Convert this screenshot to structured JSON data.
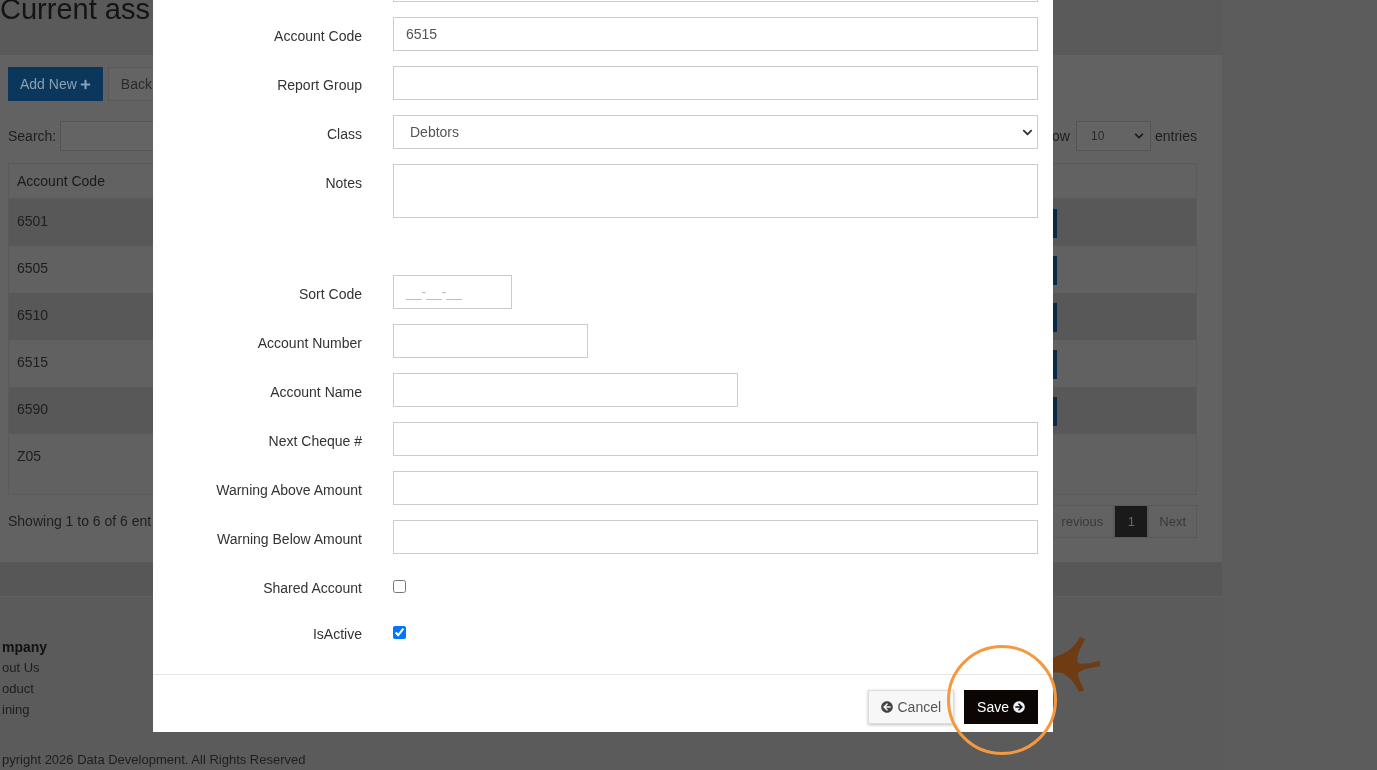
{
  "page": {
    "title": "Current ass",
    "add_button": "Add New",
    "back_button": "Back",
    "search_label": "Search:",
    "length_prefix": "ow",
    "length_value": "10",
    "length_suffix": "entries",
    "table": {
      "columns": [
        "Account Code"
      ],
      "rows": [
        {
          "code": "6501",
          "has_action": true
        },
        {
          "code": "6505",
          "has_action": true
        },
        {
          "code": "6510",
          "has_action": true
        },
        {
          "code": "6515",
          "has_action": true
        },
        {
          "code": "6590",
          "has_action": true
        },
        {
          "code": "Z05",
          "has_action": false
        }
      ]
    },
    "info": "Showing 1 to 6 of 6 ent",
    "pagination": [
      {
        "label": "revious",
        "selected": false
      },
      {
        "label": "1",
        "selected": true
      },
      {
        "label": "Next",
        "selected": false
      }
    ]
  },
  "footer": {
    "heading": "mpany",
    "links": [
      "out Us",
      "oduct",
      "ining"
    ],
    "copyright": "pyright 2026 Data Development. All Rights Reserved"
  },
  "modal": {
    "fields": [
      {
        "kind": "text"
      },
      {
        "kind": "text",
        "label": "Account Code",
        "value": "6515"
      },
      {
        "kind": "text",
        "label": "Report Group"
      },
      {
        "kind": "select",
        "label": "Class",
        "value": "Debtors"
      },
      {
        "kind": "textarea",
        "label": "Notes"
      },
      {
        "kind": "sort_code",
        "label": "Sort Code",
        "placeholder": "__-__-__"
      },
      {
        "kind": "account_number",
        "label": "Account Number"
      },
      {
        "kind": "account_name",
        "label": "Account Name"
      },
      {
        "kind": "text",
        "label": "Next Cheque #"
      },
      {
        "kind": "text",
        "label": "Warning Above Amount"
      },
      {
        "kind": "text",
        "label": "Warning Below Amount"
      },
      {
        "kind": "checkbox",
        "label": "Shared Account",
        "checked": false
      },
      {
        "kind": "checkbox",
        "label": "IsActive",
        "checked": true
      }
    ],
    "buttons": [
      {
        "kind": "cancel",
        "label": "Cancel"
      },
      {
        "kind": "save",
        "label": "Save"
      }
    ],
    "highlight_ring": true
  }
}
